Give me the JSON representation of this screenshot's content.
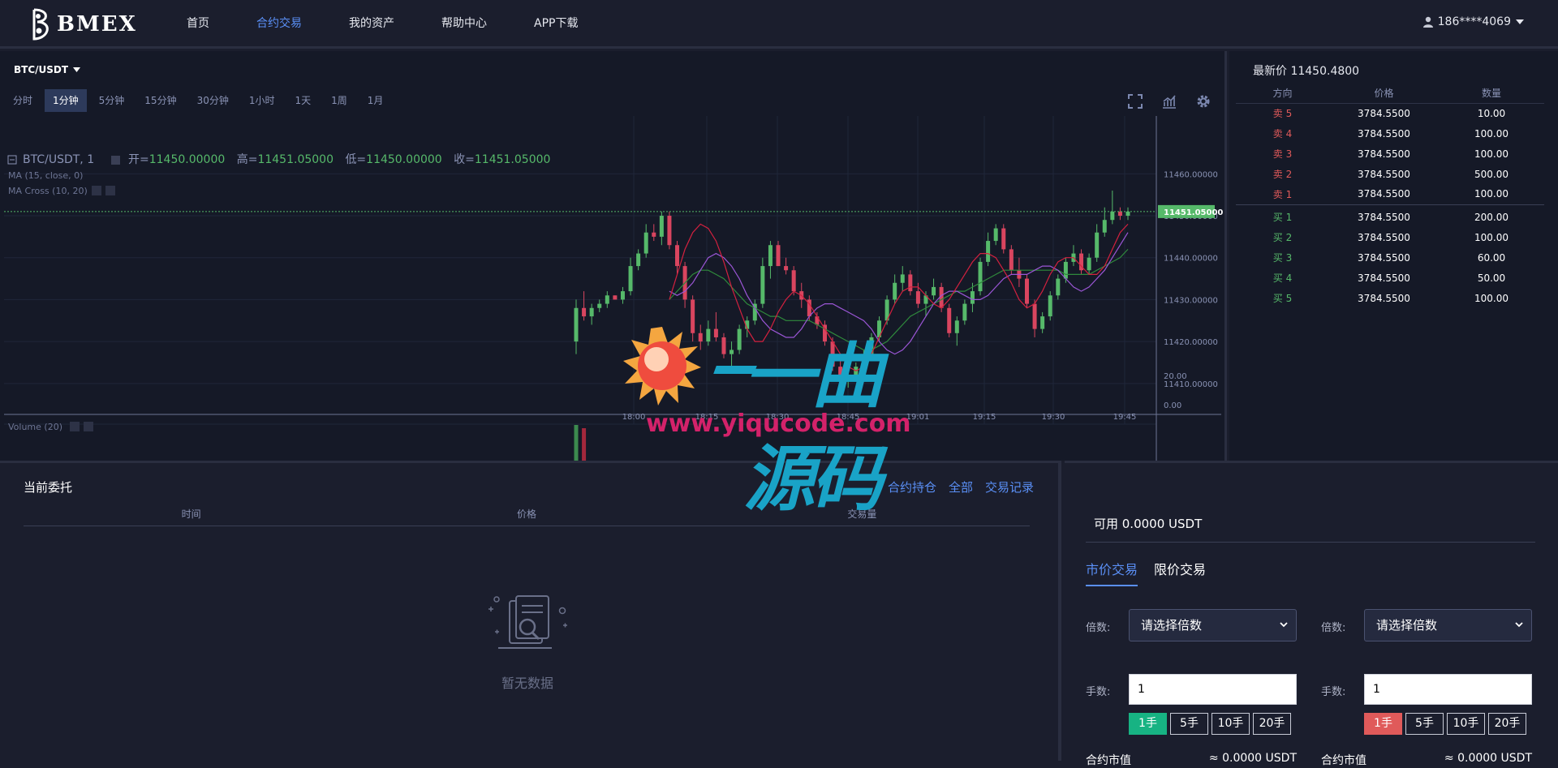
{
  "app": {
    "logo_text": "BMEX",
    "user": "186****4069"
  },
  "nav": [
    "首页",
    "合约交易",
    "我的资产",
    "帮助中心",
    "APP下载"
  ],
  "nav_active": 1,
  "chart": {
    "symbol": "BTC/USDT",
    "intervals": [
      "分时",
      "1分钟",
      "5分钟",
      "15分钟",
      "30分钟",
      "1小时",
      "1天",
      "1周",
      "1月"
    ],
    "active_interval": 1,
    "legend_symbol": "BTC/USDT, 1",
    "open_label": "开=",
    "open": "11450.00000",
    "high_label": "高=",
    "high": "11451.05000",
    "low_label": "低=",
    "low": "11450.00000",
    "close_label": "收=",
    "close": "11451.05000",
    "ma_label": "MA (15, close, 0)",
    "macross_label": "MA Cross (10, 20)",
    "volume_label": "Volume (20)",
    "last_price_tag": "11451.05000"
  },
  "chart_data": {
    "type": "candlestick",
    "price_ticks": [
      "11460.00000",
      "11450.00000",
      "11440.00000",
      "11430.00000",
      "11420.00000",
      "11410.00000"
    ],
    "volume_ticks": [
      "20.00",
      "0.00"
    ],
    "x_ticks": [
      "18:00",
      "18:15",
      "18:30",
      "18:45",
      "19:01",
      "19:15",
      "19:30",
      "19:45"
    ],
    "price_range": [
      11403,
      11468
    ],
    "volume_range": [
      0,
      34
    ],
    "candles": [
      [
        11420,
        11430,
        11417,
        11428,
        28
      ],
      [
        11428,
        11432,
        11425,
        11426,
        26
      ],
      [
        11426,
        11429,
        11424,
        11428,
        3
      ],
      [
        11428,
        11430,
        11427,
        11429,
        1
      ],
      [
        11429,
        11432,
        11428,
        11431,
        1
      ],
      [
        11431,
        11431,
        11430,
        11430,
        1
      ],
      [
        11430,
        11433,
        11429,
        11432,
        1
      ],
      [
        11432,
        11440,
        11431,
        11438,
        1
      ],
      [
        11438,
        11442,
        11437,
        11441,
        1
      ],
      [
        11441,
        11448,
        11440,
        11446,
        1
      ],
      [
        11446,
        11448,
        11444,
        11445,
        1
      ],
      [
        11445,
        11451,
        11443,
        11450,
        3
      ],
      [
        11450,
        11451,
        11442,
        11443,
        2
      ],
      [
        11443,
        11444,
        11436,
        11438,
        2
      ],
      [
        11438,
        11439,
        11428,
        11430,
        3
      ],
      [
        11430,
        11431,
        11420,
        11422,
        2
      ],
      [
        11422,
        11424,
        11418,
        11420,
        1
      ],
      [
        11420,
        11425,
        11419,
        11423,
        1
      ],
      [
        11423,
        11427,
        11420,
        11421,
        1
      ],
      [
        11421,
        11422,
        11416,
        11417,
        1
      ],
      [
        11417,
        11420,
        11413,
        11418,
        1
      ],
      [
        11418,
        11424,
        11417,
        11423,
        1
      ],
      [
        11423,
        11426,
        11421,
        11425,
        1
      ],
      [
        11425,
        11430,
        11424,
        11429,
        1
      ],
      [
        11429,
        11440,
        11428,
        11438,
        1
      ],
      [
        11438,
        11444,
        11435,
        11443,
        1
      ],
      [
        11443,
        11444,
        11438,
        11438,
        1
      ],
      [
        11438,
        11440,
        11436,
        11437,
        1
      ],
      [
        11437,
        11438,
        11431,
        11432,
        1
      ],
      [
        11432,
        11434,
        11428,
        11430,
        1
      ],
      [
        11430,
        11431,
        11425,
        11426,
        1
      ],
      [
        11426,
        11427,
        11423,
        11424,
        1
      ],
      [
        11424,
        11425,
        11419,
        11420,
        1
      ],
      [
        11420,
        11421,
        11413,
        11414,
        1
      ],
      [
        11414,
        11416,
        11410,
        11411,
        1
      ],
      [
        11411,
        11413,
        11409,
        11412,
        1
      ],
      [
        11412,
        11415,
        11411,
        11414,
        1
      ],
      [
        11414,
        11418,
        11413,
        11417,
        1
      ],
      [
        11417,
        11422,
        11416,
        11421,
        1
      ],
      [
        11421,
        11426,
        11420,
        11425,
        1
      ],
      [
        11425,
        11431,
        11424,
        11430,
        1
      ],
      [
        11430,
        11436,
        11429,
        11434,
        1
      ],
      [
        11434,
        11438,
        11432,
        11436,
        1
      ],
      [
        11436,
        11437,
        11431,
        11432,
        1
      ],
      [
        11432,
        11434,
        11428,
        11429,
        1
      ],
      [
        11429,
        11432,
        11426,
        11431,
        1
      ],
      [
        11431,
        11435,
        11430,
        11433,
        1
      ],
      [
        11433,
        11434,
        11427,
        11428,
        1
      ],
      [
        11428,
        11429,
        11421,
        11422,
        1
      ],
      [
        11422,
        11426,
        11419,
        11425,
        1
      ],
      [
        11425,
        11430,
        11424,
        11429,
        1
      ],
      [
        11429,
        11434,
        11427,
        11432,
        1
      ],
      [
        11432,
        11440,
        11431,
        11439,
        1
      ],
      [
        11439,
        11446,
        11438,
        11444,
        1
      ],
      [
        11444,
        11448,
        11443,
        11447,
        1
      ],
      [
        11447,
        11448,
        11441,
        11442,
        1
      ],
      [
        11442,
        11443,
        11436,
        11437,
        1
      ],
      [
        11437,
        11440,
        11433,
        11435,
        1
      ],
      [
        11435,
        11436,
        11428,
        11429,
        1
      ],
      [
        11429,
        11430,
        11421,
        11423,
        1
      ],
      [
        11423,
        11427,
        11422,
        11426,
        1
      ],
      [
        11426,
        11432,
        11425,
        11431,
        1
      ],
      [
        11431,
        11436,
        11430,
        11435,
        1
      ],
      [
        11435,
        11440,
        11434,
        11439,
        3
      ],
      [
        11439,
        11443,
        11438,
        11441,
        1
      ],
      [
        11441,
        11442,
        11436,
        11437,
        1
      ],
      [
        11437,
        11441,
        11436,
        11440,
        1
      ],
      [
        11440,
        11448,
        11439,
        11446,
        1
      ],
      [
        11446,
        11452,
        11445,
        11449,
        1
      ],
      [
        11449,
        11456,
        11448,
        11451,
        1
      ],
      [
        11451,
        11452,
        11449,
        11450,
        1
      ],
      [
        11450,
        11452,
        11449,
        11451,
        1
      ]
    ],
    "ma_purple": [
      11432,
      11431,
      11432,
      11434,
      11437,
      11440,
      11441,
      11440,
      11438,
      11435,
      11431,
      11428,
      11425,
      11423,
      11422,
      11421,
      11421,
      11423,
      11426,
      11428,
      11429,
      11429,
      11428,
      11427,
      11426,
      11425,
      11423,
      11420,
      11418,
      11417,
      11418,
      11420,
      11423,
      11426,
      11429,
      11431,
      11432,
      11432,
      11431,
      11430,
      11430,
      11431,
      11433,
      11435,
      11436,
      11436,
      11436,
      11437,
      11438,
      11438,
      11437,
      11435,
      11433,
      11432,
      11433,
      11435,
      11437,
      11440,
      11443,
      11446
    ],
    "ma_red": [
      11430,
      11436,
      11442,
      11446,
      11448,
      11447,
      11444,
      11439,
      11433,
      11428,
      11423,
      11420,
      11420,
      11423,
      11427,
      11430,
      11432,
      11431,
      11429,
      11426,
      11423,
      11420,
      11417,
      11414,
      11413,
      11414,
      11417,
      11421,
      11425,
      11429,
      11432,
      11433,
      11433,
      11431,
      11429,
      11428,
      11430,
      11433,
      11436,
      11439,
      11441,
      11441,
      11440,
      11437,
      11434,
      11430,
      11428,
      11429,
      11432,
      11436,
      11439,
      11440,
      11440,
      11438,
      11436,
      11436,
      11438,
      11442,
      11446,
      11448
    ],
    "ma_green": [
      11430,
      11432,
      11434,
      11436,
      11437,
      11437,
      11436,
      11435,
      11433,
      11431,
      11429,
      11428,
      11427,
      11426,
      11426,
      11425,
      11425,
      11425,
      11425,
      11424,
      11423,
      11422,
      11421,
      11420,
      11419,
      11418,
      11418,
      11419,
      11420,
      11422,
      11424,
      11426,
      11427,
      11428,
      11429,
      11430,
      11431,
      11432,
      11432,
      11433,
      11434,
      11435,
      11436,
      11437,
      11437,
      11437,
      11437,
      11437,
      11437,
      11437,
      11437,
      11436,
      11436,
      11436,
      11436,
      11437,
      11438,
      11439,
      11440,
      11442
    ]
  },
  "order_book": {
    "title_label": "最新价",
    "title_price": "11450.4800",
    "headers": [
      "方向",
      "价格",
      "数量"
    ],
    "asks": [
      {
        "dir": "卖 5",
        "price": "3784.5500",
        "qty": "10.00"
      },
      {
        "dir": "卖 4",
        "price": "3784.5500",
        "qty": "100.00"
      },
      {
        "dir": "卖 3",
        "price": "3784.5500",
        "qty": "100.00"
      },
      {
        "dir": "卖 2",
        "price": "3784.5500",
        "qty": "500.00"
      },
      {
        "dir": "卖 1",
        "price": "3784.5500",
        "qty": "100.00"
      }
    ],
    "bids": [
      {
        "dir": "买 1",
        "price": "3784.5500",
        "qty": "200.00"
      },
      {
        "dir": "买 2",
        "price": "3784.5500",
        "qty": "100.00"
      },
      {
        "dir": "买 3",
        "price": "3784.5500",
        "qty": "60.00"
      },
      {
        "dir": "买 4",
        "price": "3784.5500",
        "qty": "50.00"
      },
      {
        "dir": "买 5",
        "price": "3784.5500",
        "qty": "100.00"
      }
    ]
  },
  "orders": {
    "title": "当前委托",
    "links": [
      "合约持仓",
      "全部",
      "交易记录"
    ],
    "headers": [
      "时间",
      "价格",
      "交易量"
    ],
    "empty_text": "暂无数据"
  },
  "trade": {
    "available": "可用 0.0000 USDT",
    "tabs": [
      "市价交易",
      "限价交易"
    ],
    "leverage_label": "倍数:",
    "leverage_placeholder": "请选择倍数",
    "qty_label": "手数:",
    "qty_value": "1",
    "lots": [
      "1手",
      "5手",
      "10手",
      "20手"
    ],
    "value_label": "合约市值",
    "value_amount": "≈ 0.0000 USDT"
  },
  "watermark": {
    "text": "一曲源码",
    "url": "www.yiqucode.com"
  },
  "colors": {
    "up": "#56b96a",
    "down": "#d9455f",
    "accent": "#5a8ff5",
    "buy": "#17b383",
    "sell": "#e05a5a"
  }
}
